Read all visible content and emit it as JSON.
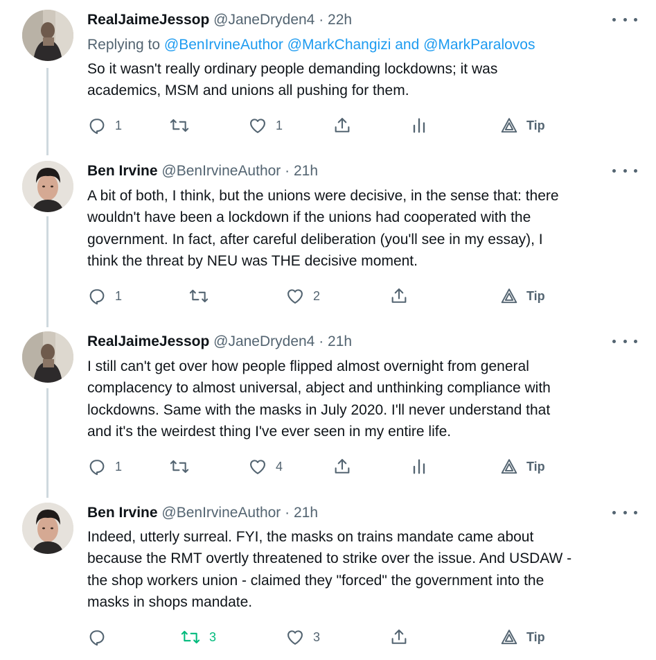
{
  "tweets": [
    {
      "name": "RealJaimeJessop",
      "handle": "@JaneDryden4",
      "dot": "·",
      "time": "22h",
      "replying_prefix": "Replying to",
      "replying_mentions": [
        "@BenIrvineAuthor",
        "@MarkChangizi",
        "and",
        "@MarkParalovos"
      ],
      "lines": [
        "So it wasn't really ordinary people demanding lockdowns; it was",
        "academics, MSM and unions all pushing for them."
      ],
      "reply_count": "1",
      "retweet_count": "",
      "like_count": "1",
      "tip_label": "Tip"
    },
    {
      "name": "Ben Irvine",
      "handle": "@BenIrvineAuthor",
      "dot": "·",
      "time": "21h",
      "lines": [
        "A bit of both, I think, but the unions were decisive, in the sense that: there",
        "wouldn't have been a lockdown if the unions had cooperated with the",
        "government. In fact, after careful deliberation (you'll see in my essay), I",
        "think the threat by NEU was THE decisive moment."
      ],
      "reply_count": "1",
      "retweet_count": "",
      "like_count": "2",
      "tip_label": "Tip"
    },
    {
      "name": "RealJaimeJessop",
      "handle": "@JaneDryden4",
      "dot": "·",
      "time": "21h",
      "lines": [
        "I still can't get over how people flipped almost overnight from general",
        "complacency to almost universal, abject and unthinking compliance with",
        "lockdowns. Same with the masks in July 2020. I'll never understand that",
        "and it's the weirdest thing I've ever seen in my entire life."
      ],
      "reply_count": "1",
      "retweet_count": "",
      "like_count": "4",
      "tip_label": "Tip"
    },
    {
      "name": "Ben Irvine",
      "handle": "@BenIrvineAuthor",
      "dot": "·",
      "time": "21h",
      "lines": [
        "Indeed, utterly surreal. FYI, the masks on trains mandate came about",
        "because the RMT overtly threatened to strike over the issue. And USDAW -",
        "the shop workers union - claimed they \"forced\" the government into the",
        "masks in shops mandate."
      ],
      "reply_count": "",
      "retweet_count": "3",
      "like_count": "3",
      "tip_label": "Tip"
    }
  ],
  "icons": {
    "reply": "reply-icon",
    "retweet": "retweet-icon",
    "like": "heart-icon",
    "share": "share-icon",
    "analytics": "analytics-icon",
    "tip": "tip-icon",
    "more": "more-icon"
  },
  "colors": {
    "text": "#0f1419",
    "secondary": "#536471",
    "link": "#1d9bf0",
    "retweeted": "#00ba7c",
    "thread_rail": "#cfd9de"
  }
}
